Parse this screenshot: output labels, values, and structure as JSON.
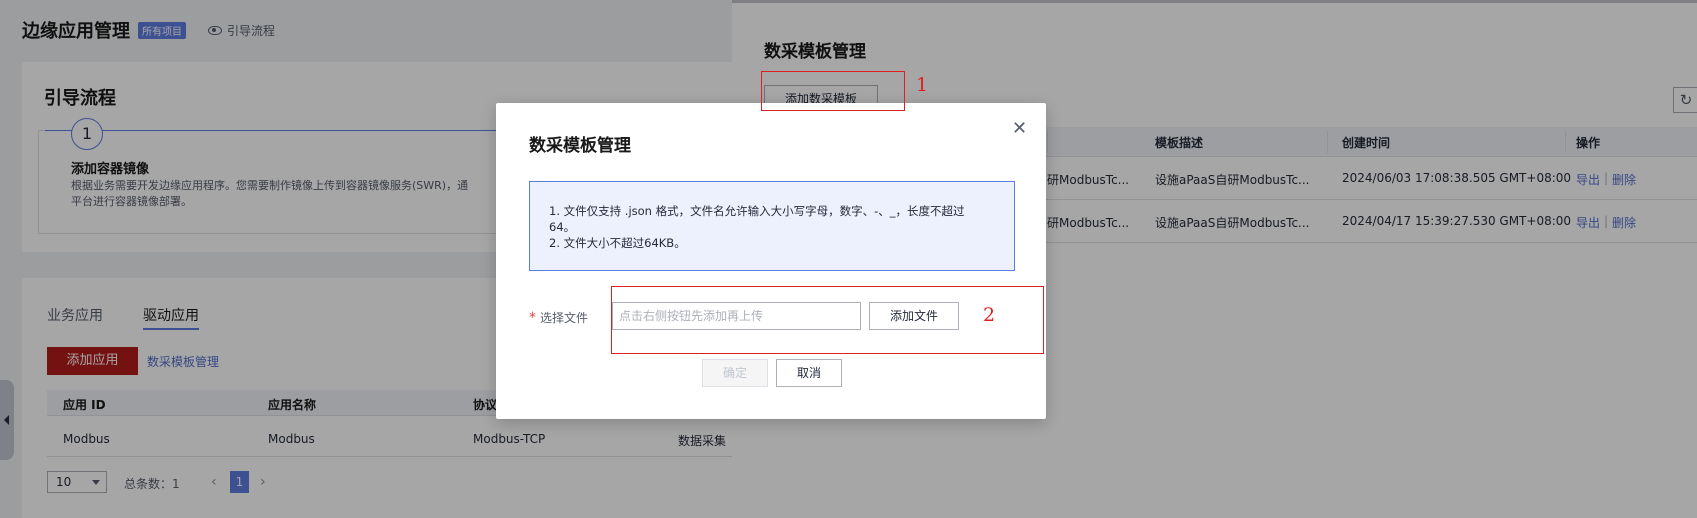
{
  "header": {
    "title": "边缘应用管理",
    "badge": "所有项目",
    "guide_link": "引导流程"
  },
  "guide_card": {
    "title": "引导流程",
    "step_number": "1",
    "step_title": "添加容器镜像",
    "step_desc_line1": "根据业务需要开发边缘应用程序。您需要制作镜像上传到容器镜像服务(SWR)，通",
    "step_desc_line2": "平台进行容器镜像部署。"
  },
  "app_panel": {
    "tabs": [
      "业务应用",
      "驱动应用"
    ],
    "add_button": "添加应用",
    "template_link": "数采模板管理",
    "columns": [
      "应用 ID",
      "应用名称",
      "协议"
    ],
    "row": {
      "id": "Modbus",
      "name": "Modbus",
      "protocol": "Modbus-TCP",
      "extra": "数据采集"
    },
    "pagination": {
      "page_size": "10",
      "total": "总条数：1",
      "prev": "‹",
      "next": "›",
      "current": "1"
    }
  },
  "drawer": {
    "title": "数采模板管理",
    "add_button": "添加数采模板",
    "refresh_icon": "refresh-icon",
    "columns": [
      "模板描述",
      "创建时间",
      "操作"
    ],
    "rows": [
      {
        "name_partial": "研ModbusTc...",
        "desc": "设施aPaaS自研ModbusTc...",
        "time": "2024/06/03 17:08:38.505 GMT+08:00",
        "export": "导出",
        "delete": "删除"
      },
      {
        "name_partial": "研ModbusTc...",
        "desc": "设施aPaaS自研ModbusTc...",
        "time": "2024/04/17 15:39:27.530 GMT+08:00",
        "export": "导出",
        "delete": "删除"
      }
    ],
    "separator": "|"
  },
  "modal": {
    "title": "数采模板管理",
    "close_icon": "close-icon",
    "info_line1": "1. 文件仅支持 .json 格式，文件名允许输入大小写字母，数字、-、_，长度不超过",
    "info_line2": "64。",
    "info_line3": "2. 文件大小不超过64KB。",
    "required_mark": "*",
    "file_label": "选择文件",
    "file_placeholder": "点击右侧按钮先添加再上传",
    "add_file_button": "添加文件",
    "ok_button": "确定",
    "cancel_button": "取消"
  },
  "annotations": {
    "one": "1",
    "two": "2",
    "color": "#e02020"
  }
}
